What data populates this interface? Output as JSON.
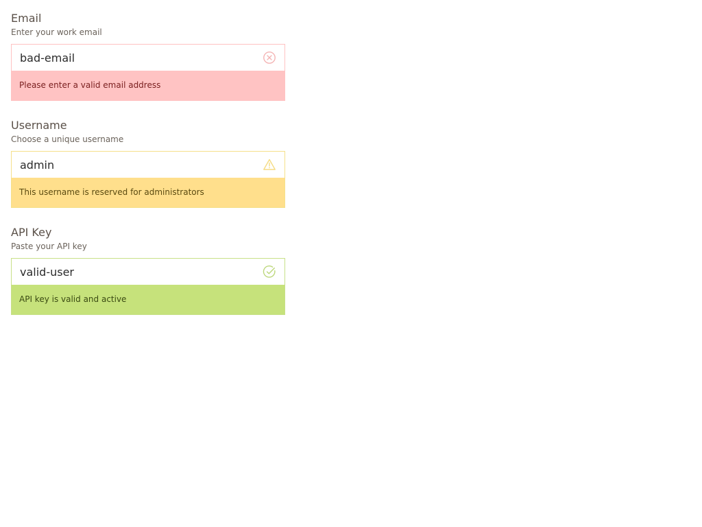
{
  "fields": [
    {
      "label": "Email",
      "hint": "Enter your work email",
      "value": "bad-email",
      "icon": "error-circle-icon",
      "status": "error",
      "message": "Please enter a valid email address",
      "color": "#ffc3c3"
    },
    {
      "label": "Username",
      "hint": "Choose a unique username",
      "value": "admin",
      "icon": "warning-triangle-icon",
      "status": "warning",
      "message": "This username is reserved for administrators",
      "color": "#ffdf8c"
    },
    {
      "label": "API Key",
      "hint": "Paste your API key",
      "value": "valid-user",
      "icon": "check-circle-icon",
      "status": "success",
      "message": "API key is valid and active",
      "color": "#c6e27b"
    }
  ]
}
